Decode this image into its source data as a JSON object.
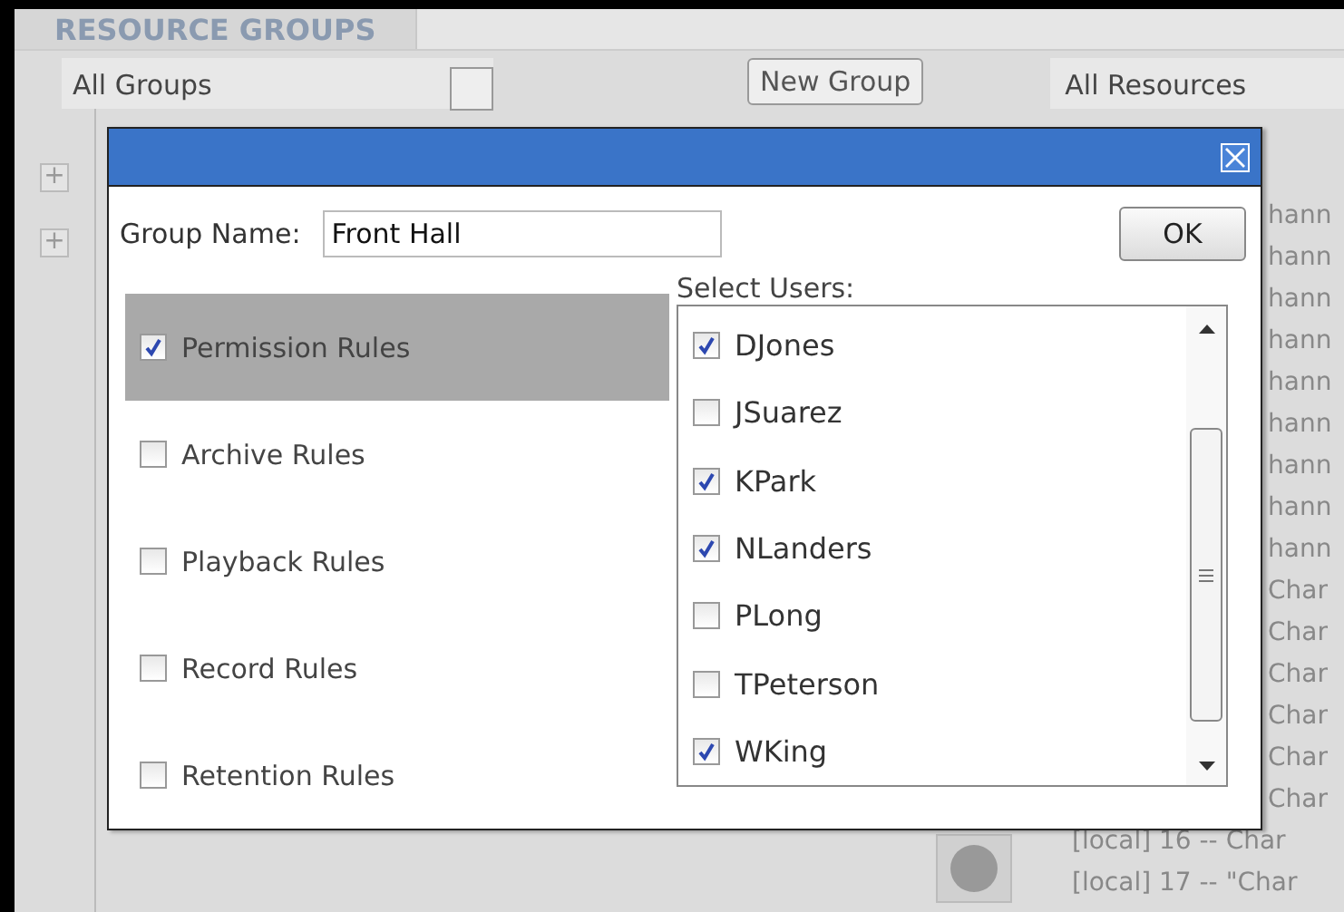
{
  "background": {
    "tab": {
      "label": "RESOURCE GROUPS",
      "selected": true
    },
    "group_filter": {
      "value": "All Groups"
    },
    "new_group_button": "New Group",
    "resource_filter": {
      "value": "All Resources"
    },
    "tree_expanders": [
      "+",
      "+"
    ],
    "resource_rows": [
      {
        "kind": "clipped",
        "text": "hann"
      },
      {
        "kind": "clipped",
        "text": "hann"
      },
      {
        "kind": "clipped",
        "text": "hann"
      },
      {
        "kind": "clipped",
        "text": "hann"
      },
      {
        "kind": "clipped",
        "text": "hann"
      },
      {
        "kind": "clipped",
        "text": "hann"
      },
      {
        "kind": "clipped",
        "text": "hann"
      },
      {
        "kind": "clipped",
        "text": "hann"
      },
      {
        "kind": "clipped",
        "text": "hann"
      },
      {
        "kind": "clipped",
        "text": "Char"
      },
      {
        "kind": "clipped",
        "text": "Char"
      },
      {
        "kind": "clipped",
        "text": "Char"
      },
      {
        "kind": "clipped",
        "text": "Char"
      },
      {
        "kind": "clipped",
        "text": "Char"
      },
      {
        "kind": "clipped",
        "text": "Char"
      },
      {
        "kind": "full",
        "text": "[local] 16 --  Char"
      },
      {
        "kind": "full",
        "text": "[local] 17 -- \"Char"
      }
    ]
  },
  "dialog": {
    "group_name": {
      "label": "Group Name:",
      "value": "Front Hall"
    },
    "ok_button": "OK",
    "rules": [
      {
        "label": "Permission Rules",
        "checked": true,
        "selected": true
      },
      {
        "label": "Archive Rules",
        "checked": false,
        "selected": false
      },
      {
        "label": "Playback Rules",
        "checked": false,
        "selected": false
      },
      {
        "label": "Record Rules",
        "checked": false,
        "selected": false
      },
      {
        "label": "Retention Rules",
        "checked": false,
        "selected": false
      }
    ],
    "users_label": "Select Users:",
    "users": [
      {
        "name": "DJones",
        "checked": true
      },
      {
        "name": "JSuarez",
        "checked": false
      },
      {
        "name": "KPark",
        "checked": true
      },
      {
        "name": "NLanders",
        "checked": true
      },
      {
        "name": "PLong",
        "checked": false
      },
      {
        "name": "TPeterson",
        "checked": false
      },
      {
        "name": "WKing",
        "checked": true
      }
    ]
  }
}
